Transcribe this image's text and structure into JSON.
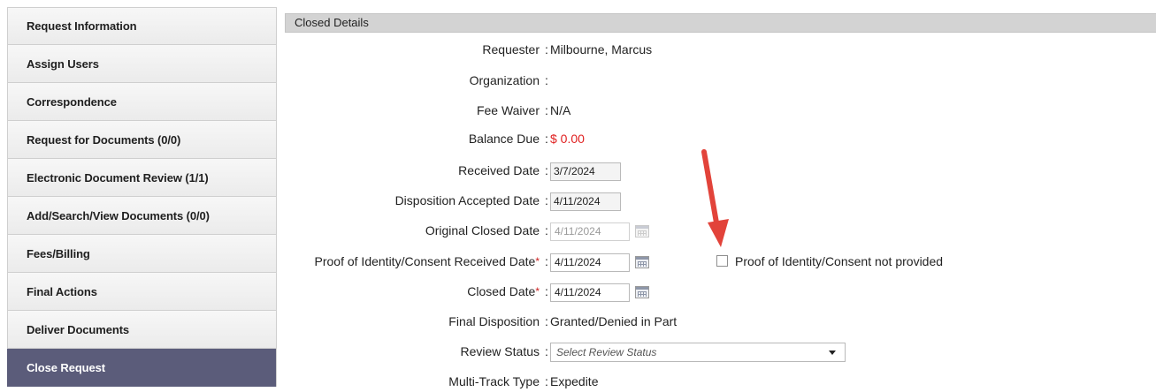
{
  "sidebar": {
    "items": [
      {
        "label": "Request Information"
      },
      {
        "label": "Assign Users"
      },
      {
        "label": "Correspondence"
      },
      {
        "label": "Request for Documents (0/0)"
      },
      {
        "label": "Electronic Document Review (1/1)"
      },
      {
        "label": "Add/Search/View Documents (0/0)"
      },
      {
        "label": "Fees/Billing"
      },
      {
        "label": "Final Actions"
      },
      {
        "label": "Deliver Documents"
      },
      {
        "label": "Close Request"
      }
    ],
    "active_index": 9
  },
  "panel": {
    "title": "Closed Details",
    "colon": ":",
    "required_mark": "*",
    "fields": {
      "requester": {
        "label": "Requester",
        "value": "Milbourne, Marcus"
      },
      "organization": {
        "label": "Organization",
        "value": ""
      },
      "fee_waiver": {
        "label": "Fee Waiver",
        "value": "N/A"
      },
      "balance_due": {
        "label": "Balance Due",
        "value": "$ 0.00"
      },
      "received_date": {
        "label": "Received Date",
        "value": "3/7/2024"
      },
      "disposition_accepted_date": {
        "label": "Disposition Accepted Date",
        "value": "4/11/2024"
      },
      "original_closed_date": {
        "label": "Original Closed Date",
        "value": "4/11/2024"
      },
      "proof_of_identity_date": {
        "label": "Proof of Identity/Consent Received Date",
        "value": "4/11/2024"
      },
      "proof_not_provided": {
        "label": "Proof of Identity/Consent not provided",
        "checked": false
      },
      "closed_date": {
        "label": "Closed Date",
        "value": "4/11/2024"
      },
      "final_disposition": {
        "label": "Final Disposition",
        "value": "Granted/Denied in Part"
      },
      "review_status": {
        "label": "Review Status",
        "placeholder": "Select Review Status"
      },
      "multi_track_type": {
        "label": "Multi-Track Type",
        "value": "Expedite"
      }
    }
  },
  "colors": {
    "sidebar_active_bg": "#5b5c7a",
    "balance_red": "#e02020",
    "annotation_arrow": "#e2433a"
  },
  "icons": {
    "calendar": "calendar-icon",
    "dropdown": "chevron-down-icon",
    "annotation": "red-arrow-annotation"
  }
}
